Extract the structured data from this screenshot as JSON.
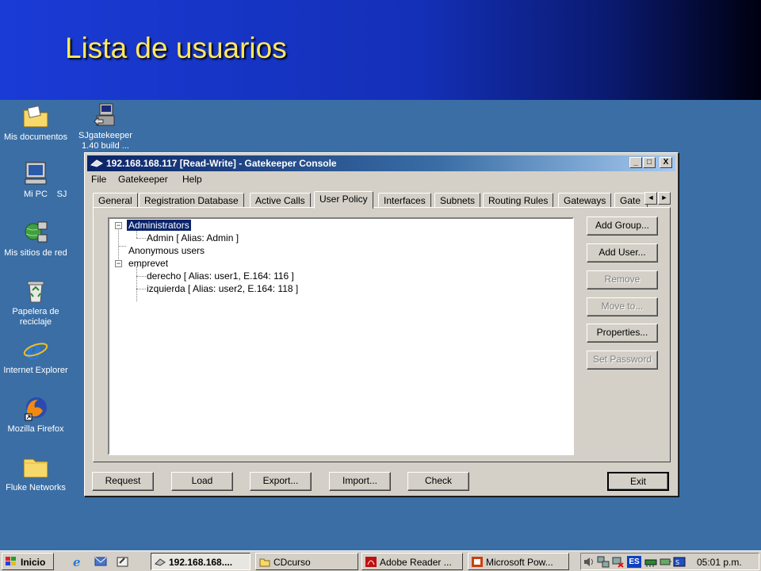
{
  "slide": {
    "title": "Lista de usuarios"
  },
  "desktop": {
    "icons": [
      {
        "label": "Mis documentos"
      },
      {
        "label": "SJgatekeeper 1.40 build ..."
      },
      {
        "label": "Mi PC"
      },
      {
        "label": "SJ"
      },
      {
        "label": "Mis sitios de red"
      },
      {
        "label": "Papelera de reciclaje"
      },
      {
        "label": "Internet Explorer"
      },
      {
        "label": "Mozilla Firefox"
      },
      {
        "label": "Fluke Networks"
      }
    ]
  },
  "window": {
    "title": "192.168.168.117 [Read-Write] - Gatekeeper Console",
    "controls": {
      "minimize": "_",
      "maximize": "□",
      "close": "X"
    },
    "menu": [
      "File",
      "Gatekeeper",
      "Help"
    ],
    "tabs": [
      {
        "label": "General"
      },
      {
        "label": "Registration Database"
      },
      {
        "label": "Active Calls"
      },
      {
        "label": "User Policy",
        "active": true
      },
      {
        "label": "Interfaces"
      },
      {
        "label": "Subnets"
      },
      {
        "label": "Routing Rules"
      },
      {
        "label": "Gateways"
      },
      {
        "label": "Gate"
      }
    ],
    "tab_scroll": {
      "left": "◄",
      "right": "►"
    },
    "tree": [
      {
        "label": "Administrators",
        "selected": true,
        "expander": "−"
      },
      {
        "label": "Admin [ Alias: Admin ]"
      },
      {
        "label": "Anonymous users"
      },
      {
        "label": "emprevet",
        "expander": "−"
      },
      {
        "label": "derecho [ Alias: user1, E.164: 116 ]"
      },
      {
        "label": "izquierda [ Alias: user2, E.164: 118 ]"
      }
    ],
    "side_buttons": [
      {
        "label": "Add Group...",
        "enabled": true
      },
      {
        "label": "Add User...",
        "enabled": true
      },
      {
        "label": "Remove",
        "enabled": false
      },
      {
        "label": "Move to...",
        "enabled": false
      },
      {
        "label": "Properties...",
        "enabled": true
      },
      {
        "label": "Set Password",
        "enabled": false
      }
    ],
    "bottom_buttons": [
      "Request",
      "Load",
      "Export...",
      "Import...",
      "Check",
      "Exit"
    ]
  },
  "taskbar": {
    "start_label": "Inicio",
    "tasks": [
      {
        "label": "192.168.168....",
        "active": true
      },
      {
        "label": "CDcurso"
      },
      {
        "label": "Adobe Reader ..."
      },
      {
        "label": "Microsoft Pow..."
      }
    ],
    "tray_lang": "ES",
    "clock": "05:01 p.m."
  },
  "colors": {
    "desktop": "#3a6ea5",
    "title_active": "#0a246a",
    "slide_title": "#ffe860",
    "face": "#d4d0c8"
  }
}
